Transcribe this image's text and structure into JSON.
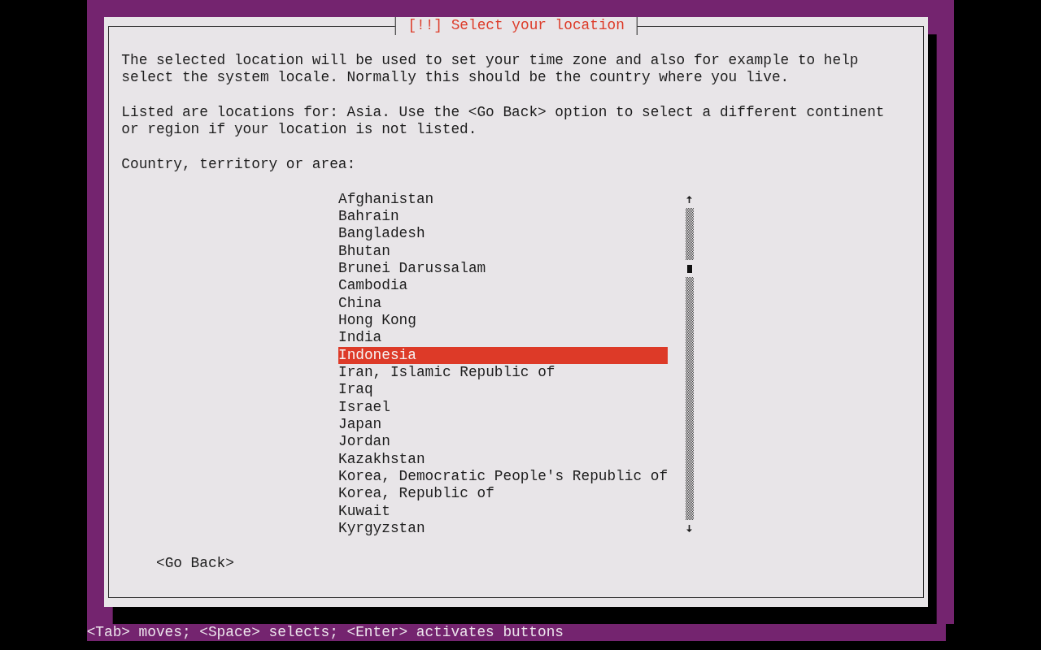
{
  "dialog": {
    "title": "[!!] Select your location",
    "paragraphs": [
      "The selected location will be used to set your time zone and also for example to help select the system locale. Normally this should be the country where you live.",
      "Listed are locations for: Asia. Use the <Go Back> option to select a different continent or region if your location is not listed."
    ],
    "list_label": "Country, territory or area:",
    "countries": [
      {
        "label": "Afghanistan",
        "selected": false
      },
      {
        "label": "Bahrain",
        "selected": false
      },
      {
        "label": "Bangladesh",
        "selected": false
      },
      {
        "label": "Bhutan",
        "selected": false
      },
      {
        "label": "Brunei Darussalam",
        "selected": false
      },
      {
        "label": "Cambodia",
        "selected": false
      },
      {
        "label": "China",
        "selected": false
      },
      {
        "label": "Hong Kong",
        "selected": false
      },
      {
        "label": "India",
        "selected": false
      },
      {
        "label": "Indonesia",
        "selected": true
      },
      {
        "label": "Iran, Islamic Republic of",
        "selected": false
      },
      {
        "label": "Iraq",
        "selected": false
      },
      {
        "label": "Israel",
        "selected": false
      },
      {
        "label": "Japan",
        "selected": false
      },
      {
        "label": "Jordan",
        "selected": false
      },
      {
        "label": "Kazakhstan",
        "selected": false
      },
      {
        "label": "Korea, Democratic People's Republic of",
        "selected": false
      },
      {
        "label": "Korea, Republic of",
        "selected": false
      },
      {
        "label": "Kuwait",
        "selected": false
      },
      {
        "label": "Kyrgyzstan",
        "selected": false
      }
    ],
    "buttons": [
      "<Go Back>"
    ]
  },
  "status_bar": "<Tab> moves; <Space> selects; <Enter> activates buttons"
}
